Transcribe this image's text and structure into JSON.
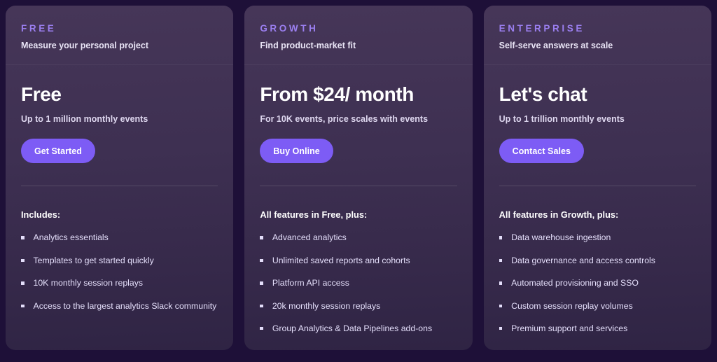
{
  "page": {
    "background_color": "#1e1038",
    "card_accent_color": "#9b7ff0",
    "cta_color": "#7d5cf5"
  },
  "plans": [
    {
      "eyebrow": "FREE",
      "tagline": "Measure your personal project",
      "price_heading": "Free",
      "price_sub": "Up to 1 million monthly events",
      "cta_label": "Get Started",
      "features_heading": "Includes:",
      "features": [
        "Analytics essentials",
        "Templates to get started quickly",
        "10K monthly session replays",
        "Access to the largest analytics Slack community"
      ]
    },
    {
      "eyebrow": "GROWTH",
      "tagline": "Find product-market fit",
      "price_heading": "From $24/ month",
      "price_sub": "For 10K events, price scales with events",
      "cta_label": "Buy Online",
      "features_heading": "All features in Free, plus:",
      "features": [
        "Advanced analytics",
        "Unlimited saved reports and cohorts",
        "Platform API access",
        "20k monthly session replays",
        "Group Analytics & Data Pipelines add-ons"
      ]
    },
    {
      "eyebrow": "ENTERPRISE",
      "tagline": "Self-serve answers at scale",
      "price_heading": "Let's chat",
      "price_sub": "Up to 1 trillion monthly events",
      "cta_label": "Contact Sales",
      "features_heading": "All features in Growth, plus:",
      "features": [
        "Data warehouse ingestion",
        "Data governance and access controls",
        "Automated provisioning and SSO",
        "Custom session replay volumes",
        "Premium support and services"
      ]
    }
  ]
}
